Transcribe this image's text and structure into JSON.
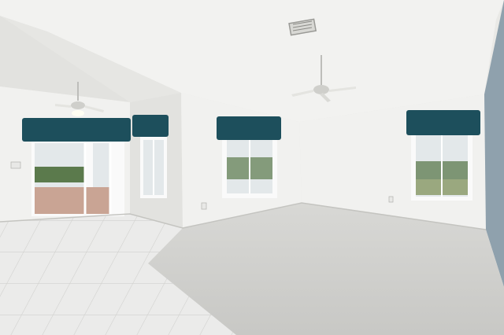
{
  "scene": {
    "description_visible_text": "",
    "colors": {
      "ceiling": "#f2f2f0",
      "ceiling_shadow": "#dcdcd8",
      "wall": "#f1f1ef",
      "wall_shade": "#e2e2df",
      "accent_wall": "#8fa1ad",
      "carpet": "#d3d3d0",
      "tile": "#ebebea",
      "tile_grout": "#cfcfcc",
      "valance": "#1d4f5c",
      "window_frame": "#fafafa",
      "glass_sky": "#e3e8ea",
      "greenery": "#5b7a4c",
      "patio_floor": "#c9a494"
    },
    "icons": [
      "ceiling-fan-icon",
      "air-vent-icon"
    ]
  }
}
